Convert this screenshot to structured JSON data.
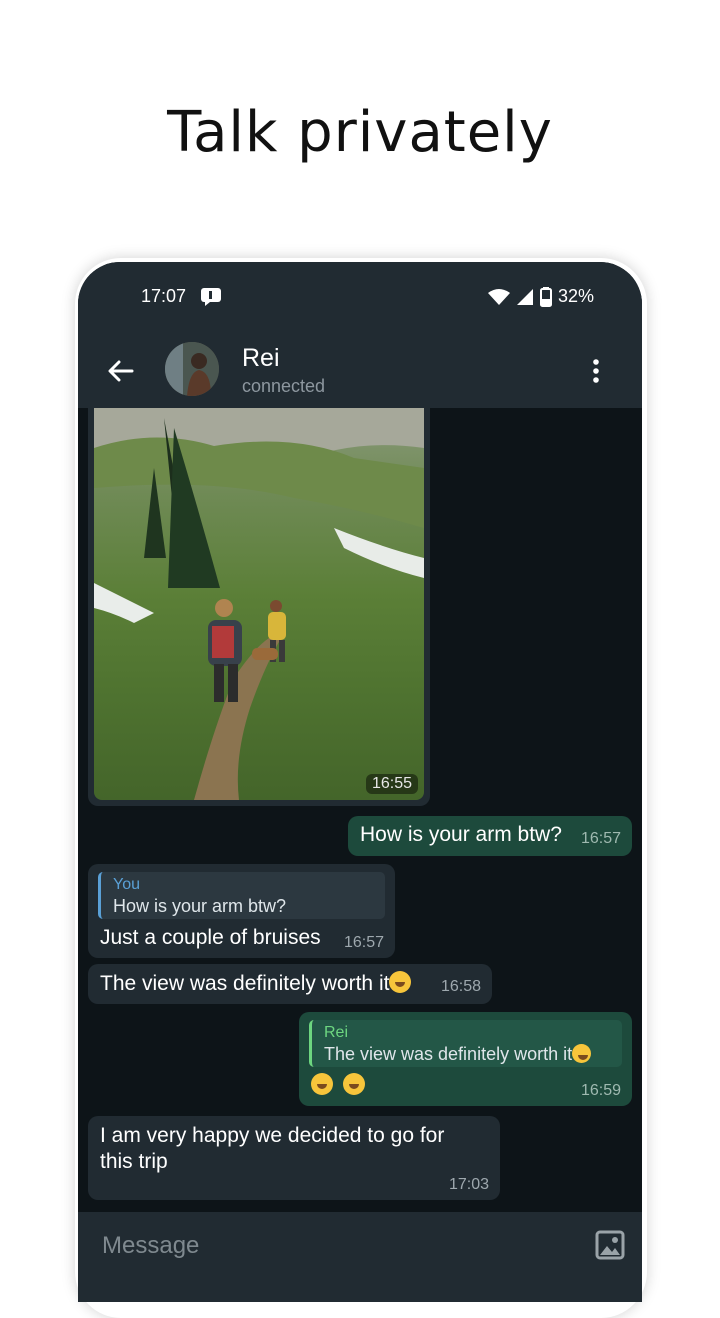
{
  "headline": "Talk privately",
  "status_bar": {
    "time": "17:07",
    "battery": "32%"
  },
  "header": {
    "contact_name": "Rei",
    "contact_status": "connected"
  },
  "messages": [
    {
      "direction": "incoming",
      "type": "photo",
      "time": "16:55"
    },
    {
      "direction": "outgoing",
      "text": "How is your arm btw?",
      "time": "16:57"
    },
    {
      "direction": "incoming",
      "quote_author": "You",
      "quote_text": "How is your arm btw?",
      "text": "Just a couple of bruises",
      "time": "16:57"
    },
    {
      "direction": "incoming",
      "text": "The view was definitely worth it",
      "time": "16:58"
    },
    {
      "direction": "outgoing",
      "quote_author": "Rei",
      "quote_text": "The view was definitely worth it",
      "time": "16:59"
    },
    {
      "direction": "incoming",
      "text_line1": "I am very happy we decided to go for",
      "text_line2": "this trip",
      "time": "17:03"
    }
  ],
  "composer": {
    "placeholder": "Message"
  },
  "colors": {
    "incoming_bubble": "#212b32",
    "outgoing_bubble": "#1d4a3c",
    "background": "#0d1418",
    "quote_you": "#5aa0d6",
    "quote_rei": "#6dd680"
  },
  "icons": [
    "notification-icon",
    "wifi-icon",
    "signal-icon",
    "battery-icon",
    "back-arrow-icon",
    "more-vert-icon",
    "gallery-icon",
    "smiley-emoji-icon"
  ]
}
